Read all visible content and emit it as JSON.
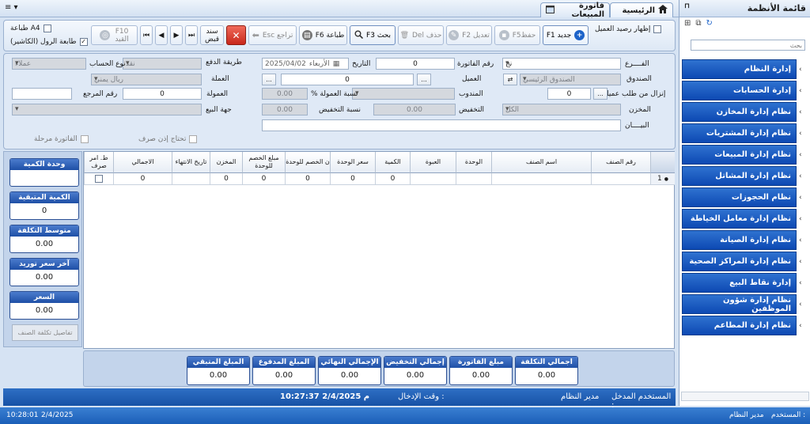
{
  "tabs": {
    "home": "الرئيسية",
    "sales": "فاتورة المبيعات"
  },
  "window_controls": "≡ ▾",
  "toolbar": {
    "new": "جديد F1",
    "save": "حفظF5",
    "edit": "تعديل F2",
    "delete": "حذف Del",
    "search": "بحث F3",
    "print": "طباعة F6",
    "undo": "تراجع Esc",
    "receipt_l1": "سند",
    "receipt_l2": "قبض",
    "f10_l1": "F10",
    "f10_l2": "القيد",
    "show_balance": "إظهار رصيد العميل",
    "a4_print": "A4 طباعة",
    "roll_print": "طابعة الرول (الكاشير)"
  },
  "form": {
    "branch_label": "الفــــرع",
    "branch_value": "نج",
    "box_label": "الصندوق",
    "box_value": "الصندوق الرئيسي",
    "order_label": "إنزال من طلب عميل",
    "order_value": "0",
    "order_btn": "...",
    "store_label": "المخزن",
    "store_value": "الكل",
    "statement_label": "البيــــان",
    "invoice_no_label": "رقم الفاتورة",
    "invoice_no_value": "0",
    "customer_label": "العميل",
    "customer_value": "0",
    "customer_btn": "...",
    "rep_label": "المندوب",
    "discount_label": "التخفيض",
    "discount_value": "0.00",
    "date_label": "التاريخ",
    "date_value": "2025/04/02",
    "date_day": "الأربعاء",
    "commission_pct_label": "نسبة العمولة %",
    "commission_pct_value": "0.00",
    "discount_pct_label": "نسبة التخفيض",
    "discount_pct_value": "0.00",
    "payment_label": "طريقة الدفع",
    "payment_value": "نقد",
    "currency_label": "العملة",
    "currency_value": "ريال يمني",
    "commission_label": "العمولة",
    "commission_value": "0",
    "sale_side_label": "جهة البيع",
    "account_type_label": "نوع الحساب",
    "account_type_value": "عملاء",
    "ref_label": "رقم المرجع",
    "needs_permit": "تحتاج إذن صرف",
    "deferred": "الفاتورة مرحلة",
    "currency_btn": "..."
  },
  "side_panels": [
    {
      "title": "وحدة الكمية",
      "value": ""
    },
    {
      "title": "الكمية المتبقية",
      "value": "0"
    },
    {
      "title": "متوسط التكلفة",
      "value": "0.00"
    },
    {
      "title": "آخر سعر توريد",
      "value": "0.00"
    },
    {
      "title": "السعر",
      "value": "0.00"
    }
  ],
  "item_details_btn": "تفاصيل تكلفة الصنف",
  "grid": {
    "headers": [
      "رقم الصنف",
      "اسم الصنف",
      "الوحدة",
      "العبوة",
      "الكمية",
      "سعر الوحدة",
      "ن الخصم للوحدة",
      "مبلغ الخصم للوحدة",
      "المخزن",
      "تاريخ الانتهاء",
      "الاجمالي",
      "ط. امر صرف"
    ],
    "row": {
      "num": "1",
      "qty": "0",
      "price": "0",
      "disc_pct": "0",
      "disc_amt": "0",
      "store": "0",
      "total": "0"
    }
  },
  "totals": [
    {
      "title": "اجمالي التكلفة",
      "value": "0.00"
    },
    {
      "title": "مبلغ الفاتورة",
      "value": "0.00"
    },
    {
      "title": "إجمالي التخفيض",
      "value": "0.00"
    },
    {
      "title": "الإجمالي النهائي",
      "value": "0.00"
    },
    {
      "title": "المبلغ المدفوع",
      "value": "0.00"
    },
    {
      "title": "المبلغ المتبقي",
      "value": "0.00"
    }
  ],
  "status": {
    "user_label": "المستخدم المدخل :",
    "user_value": "مدير النظام",
    "time_label": "وقت الإدخال :",
    "time_value": "10:27:37 2/4/2025 م"
  },
  "taskbar": {
    "user_label": "المستخدم :",
    "user_value": "مدير النظام",
    "date": "2/4/2025",
    "time": "10:28:01"
  },
  "nav": {
    "title": "قائمة الأنظمة",
    "search_placeholder": "بحث",
    "items": [
      "إدارة النظام",
      "إدارة الحسابات",
      "نظام إدارة المخازن",
      "نظام إدارة المشتريات",
      "نظام إدارة المبيعات",
      "نظام إدارة المشاتل",
      "نظام الحجوزات",
      "نظام إدارة معامل الخياطة",
      "نظام إدارة الصيانة",
      "نظام إدارة المراكز الصحية",
      "إدارة نقاط البيع",
      "نظام إدارة شؤون الموظفين",
      "نظام إدارة المطاعم"
    ]
  },
  "colors": {
    "accent": "#1752a6",
    "nav_item": "#0d49b3",
    "panel_bg": "#c3d4eb"
  }
}
